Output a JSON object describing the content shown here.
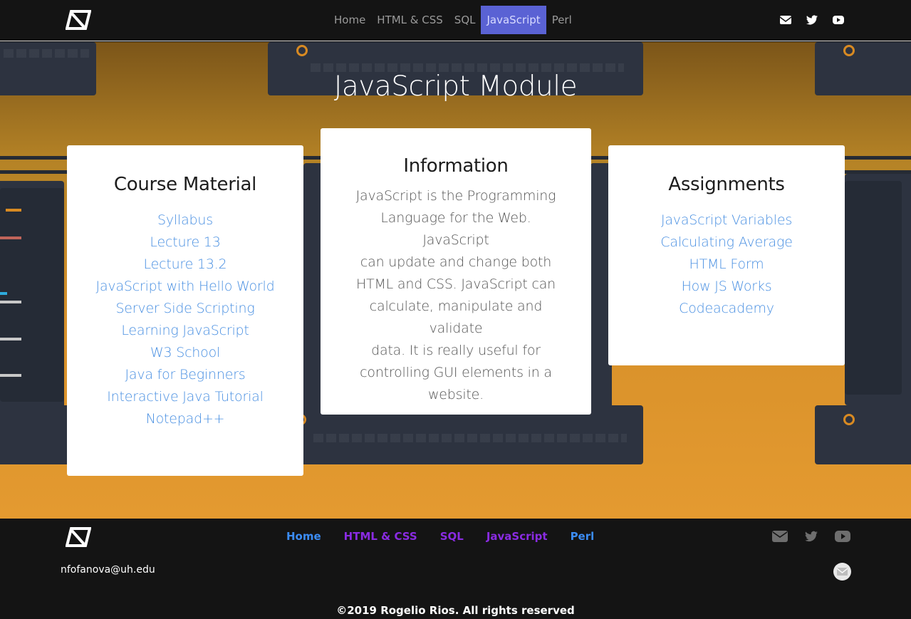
{
  "nav": {
    "logo": "logo-icon",
    "links": [
      "Home",
      "HTML & CSS",
      "SQL",
      "JavaScript",
      "Perl"
    ],
    "active": "JavaScript",
    "icons": [
      "envelope-icon",
      "twitter-icon",
      "youtube-icon"
    ]
  },
  "hero": {
    "title": "JavaScript Module"
  },
  "course_material": {
    "title": "Course Material",
    "links": [
      "Syllabus",
      "Lecture 13",
      "Lecture 13.2",
      "JavaScript with Hello World",
      "Server Side Scripting",
      "Learning JavaScript",
      "W3 School",
      "Java for Beginners",
      "Interactive Java Tutorial",
      "Notepad++"
    ]
  },
  "information": {
    "title": "Information",
    "lines": [
      "JavaScript is the Programming",
      "Language for the Web. JavaScript",
      "can update and change both",
      "HTML and CSS. JavaScript can",
      "calculate, manipulate and validate",
      "data. It is really useful for",
      "controlling GUI elements in a",
      "website."
    ]
  },
  "assignments": {
    "title": "Assignments",
    "links": [
      "JavaScript Variables",
      "Calculating Average",
      "HTML Form",
      "How JS Works",
      "Codeacademy"
    ]
  },
  "footer": {
    "links": [
      "Home",
      "HTML & CSS",
      "SQL",
      "JavaScript",
      "Perl"
    ],
    "link_colors": [
      "#3b8cf5",
      "#8a2be2",
      "#8a2be2",
      "#8a2be2",
      "#3b8cf5"
    ],
    "email": "nfofanova@uh.edu",
    "copyright": "©2019 Rogelio Rios. All rights reserved",
    "icons": [
      "envelope-icon",
      "twitter-icon",
      "youtube-icon",
      "mail-circle-icon"
    ]
  },
  "colors": {
    "active_nav": "#5a62d4",
    "link_blue": "#4a90e2",
    "hero_orange": "#e49a30",
    "dark": "#141414"
  }
}
